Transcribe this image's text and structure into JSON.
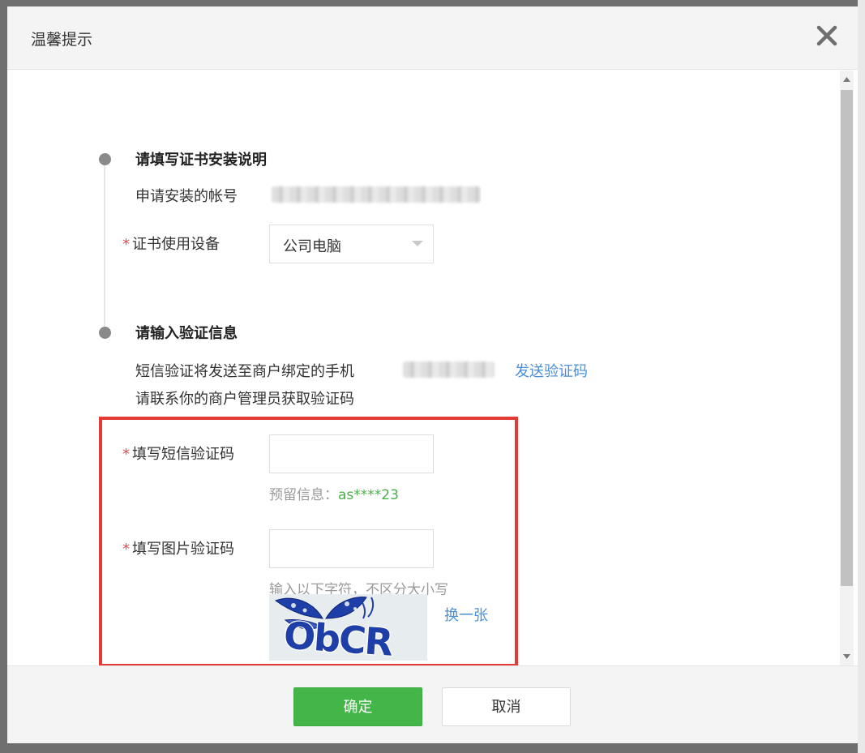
{
  "dialog": {
    "title": "温馨提示"
  },
  "step1": {
    "title": "请填写证书安装说明",
    "account_label": "申请安装的帐号",
    "device_label": "证书使用设备",
    "device_value": "公司电脑"
  },
  "step2": {
    "title": "请输入验证信息",
    "sms_notice": "短信验证将发送至商户绑定的手机",
    "send_code_link": "发送验证码",
    "contact_notice": "请联系你的商户管理员获取验证码"
  },
  "sms_field": {
    "label": "填写短信验证码",
    "value": "",
    "hint_prefix": "预留信息：",
    "hint_value": "as****23"
  },
  "image_field": {
    "label": "填写图片验证码",
    "value": "",
    "hint": "输入以下字符，不区分大小写",
    "refresh_link": "换一张",
    "captcha_text": "ObCR"
  },
  "footer": {
    "confirm_label": "确定",
    "cancel_label": "取消"
  },
  "required_mark": "*",
  "colors": {
    "primary_button": "#44b549",
    "link": "#4a90d9",
    "hint_highlight": "#4cae4c",
    "annotation_box": "#e53935",
    "required": "#e24b4b"
  }
}
